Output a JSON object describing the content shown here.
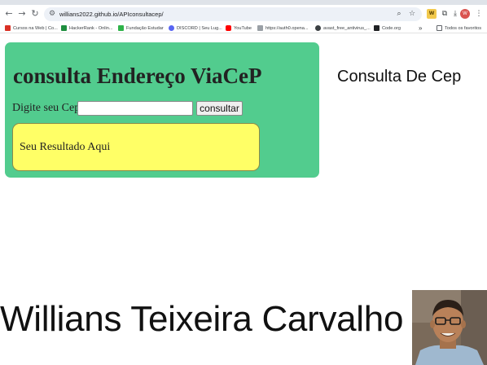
{
  "browser": {
    "url": "willians2022.github.io/APIconsultacep/",
    "nav": {
      "back": "←",
      "forward": "→",
      "reload": "↻"
    },
    "icons": [
      "tune-icon",
      "zoom-icon",
      "star-icon",
      "extension-badge-icon",
      "extensions-icon",
      "download-icon"
    ],
    "profile_initial": "W",
    "menu": "⋮"
  },
  "bookmarks": {
    "items": [
      {
        "label": "Cursos na Web | Co...",
        "color": "#d93025"
      },
      {
        "label": "HackerRank - Onlin...",
        "color": "#1e8e3e"
      },
      {
        "label": "Fundação Estudar",
        "color": "#2fb34a"
      },
      {
        "label": "DISCORD | Seu Lug...",
        "color": "#5865f2"
      },
      {
        "label": "YouTube",
        "color": "#ff0000"
      },
      {
        "label": "https://auth0.opena...",
        "color": "#9aa0a6"
      },
      {
        "label": "avast_free_antivirus_...",
        "color": "#3c4043"
      },
      {
        "label": "Code.org",
        "color": "#202124"
      }
    ],
    "overflow": "»",
    "all_favorites": "Todos os favoritos"
  },
  "page": {
    "card_title": "consulta Endereço ViaCeP",
    "cep_label": "Digite seu Cep",
    "cep_input": {
      "value": "",
      "placeholder": ""
    },
    "button_label": "consultar",
    "result_text": "Seu Resultado Aqui",
    "side_title": "Consulta De Cep",
    "author_name": "Willians Teixeira Carvalho"
  },
  "colors": {
    "card": "#52cc8e",
    "result_box": "#ffff66"
  }
}
